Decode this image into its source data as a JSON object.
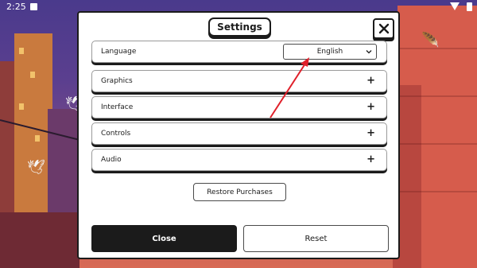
{
  "status_bar": {
    "time": "2:25"
  },
  "settings": {
    "title": "Settings",
    "rows": [
      {
        "label": "Language",
        "value": "English"
      },
      {
        "label": "Graphics",
        "expand": "+"
      },
      {
        "label": "Interface",
        "expand": "+"
      },
      {
        "label": "Controls",
        "expand": "+"
      },
      {
        "label": "Audio",
        "expand": "+"
      }
    ],
    "restore_label": "Restore Purchases",
    "close_label": "Close",
    "reset_label": "Reset"
  },
  "colors": {
    "panel_border": "#1b1b1b",
    "annotation_arrow": "#e0202a",
    "close_button_bg": "#1b1b1b"
  },
  "icons": {
    "close": "x-icon",
    "dropdown": "chevron-down-icon",
    "expand": "plus-icon"
  }
}
